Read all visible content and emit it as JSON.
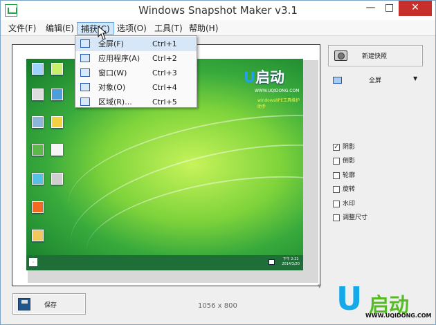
{
  "window": {
    "title": "Windows Snapshot Maker v3.1",
    "minimize": "—",
    "maximize": "□",
    "close": "✕"
  },
  "menu": [
    "文件(F)",
    "编辑(E)",
    "捕获(C)",
    "选项(O)",
    "工具(T)",
    "帮助(H)"
  ],
  "capture_menu": [
    {
      "label": "全屏(F)",
      "shortcut": "Ctrl+1",
      "icon": "fullscreen-icon"
    },
    {
      "label": "应用程序(A)",
      "shortcut": "Ctrl+2",
      "icon": "application-window-icon"
    },
    {
      "label": "窗口(W)",
      "shortcut": "Ctrl+3",
      "icon": "window-icon"
    },
    {
      "label": "对象(O)",
      "shortcut": "Ctrl+4",
      "icon": "object-selection-icon"
    },
    {
      "label": "区域(R)...",
      "shortcut": "Ctrl+5",
      "icon": "region-crop-icon"
    }
  ],
  "preview": {
    "icons": [
      "",
      "",
      "",
      "",
      "",
      "",
      "",
      "",
      "",
      "",
      "",
      "",
      "",
      ""
    ],
    "brand_u": "U",
    "brand_text": "启动",
    "brand_url": "WWW.UQIDONG.COM",
    "brand_note": "windows8PE工具维护助手",
    "clock_time": "下午 2:22",
    "clock_date": "2014/3/20"
  },
  "sidebar": {
    "capture_button": "新建快照",
    "mode": "全屏",
    "options": [
      {
        "label": "阴影",
        "checked": true
      },
      {
        "label": "倒影",
        "checked": false
      },
      {
        "label": "轮廓",
        "checked": false
      },
      {
        "label": "旋转",
        "checked": false
      },
      {
        "label": "水印",
        "checked": false
      },
      {
        "label": "调整尺寸",
        "checked": false
      }
    ]
  },
  "footer": {
    "save_button": "保存",
    "size": "1056 x 800",
    "logo_u": "U",
    "logo_text": "启动",
    "logo_url": "WWW.UQIDONG.COM"
  }
}
